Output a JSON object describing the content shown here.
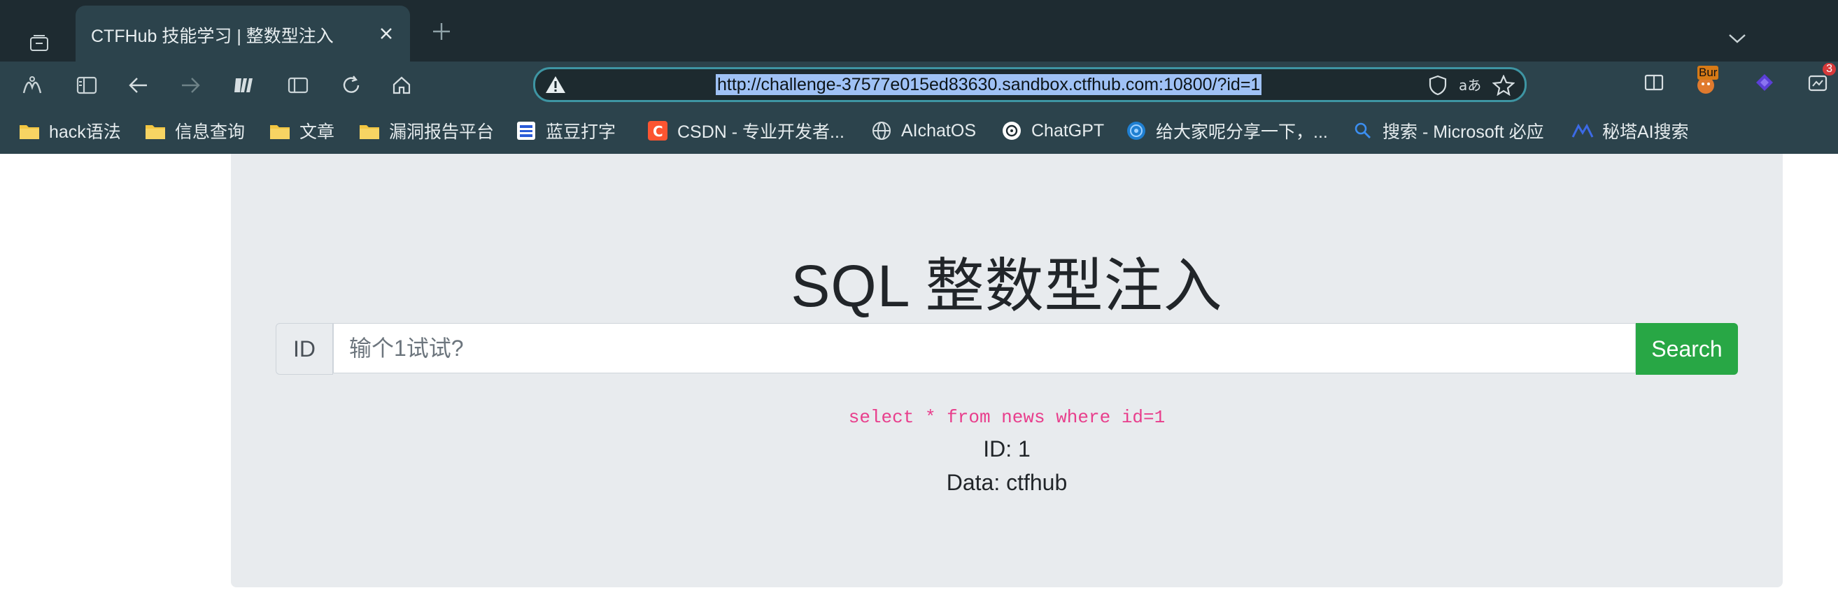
{
  "browser": {
    "tab": {
      "title": "CTFHub 技能学习 | 整数型注入"
    },
    "address": {
      "url": "http://challenge-37577e015ed83630.sandbox.ctfhub.com:10800/?id=1"
    },
    "extensions": [
      {
        "name": "burp-extension",
        "label": "Bur"
      },
      {
        "name": "notification-extension",
        "badge": "3"
      }
    ],
    "bookmarks": [
      {
        "label": "hack语法",
        "icon": "folder-icon"
      },
      {
        "label": "信息查询",
        "icon": "folder-icon"
      },
      {
        "label": "文章",
        "icon": "folder-icon"
      },
      {
        "label": "漏洞报告平台",
        "icon": "folder-icon"
      },
      {
        "label": "蓝豆打字",
        "icon": "site-icon"
      },
      {
        "label": "CSDN - 专业开发者...",
        "icon": "csdn-icon"
      },
      {
        "label": "AIchatOS",
        "icon": "globe-icon"
      },
      {
        "label": "ChatGPT",
        "icon": "chatgpt-icon"
      },
      {
        "label": "给大家呢分享一下，...",
        "icon": "site-icon"
      },
      {
        "label": "搜索 - Microsoft 必应",
        "icon": "search-icon"
      },
      {
        "label": "秘塔AI搜索",
        "icon": "site-icon"
      }
    ]
  },
  "page": {
    "title": "SQL 整数型注入",
    "form": {
      "prepend": "ID",
      "placeholder": "输个1试试?",
      "button": "Search"
    },
    "result": {
      "query": "select * from news where id=1",
      "id_line": "ID: 1",
      "data_line": "Data: ctfhub"
    }
  },
  "colors": {
    "chrome": "#2c434c",
    "accent": "#3e95a3",
    "button": "#28a745",
    "query_text": "#e83e8c"
  }
}
